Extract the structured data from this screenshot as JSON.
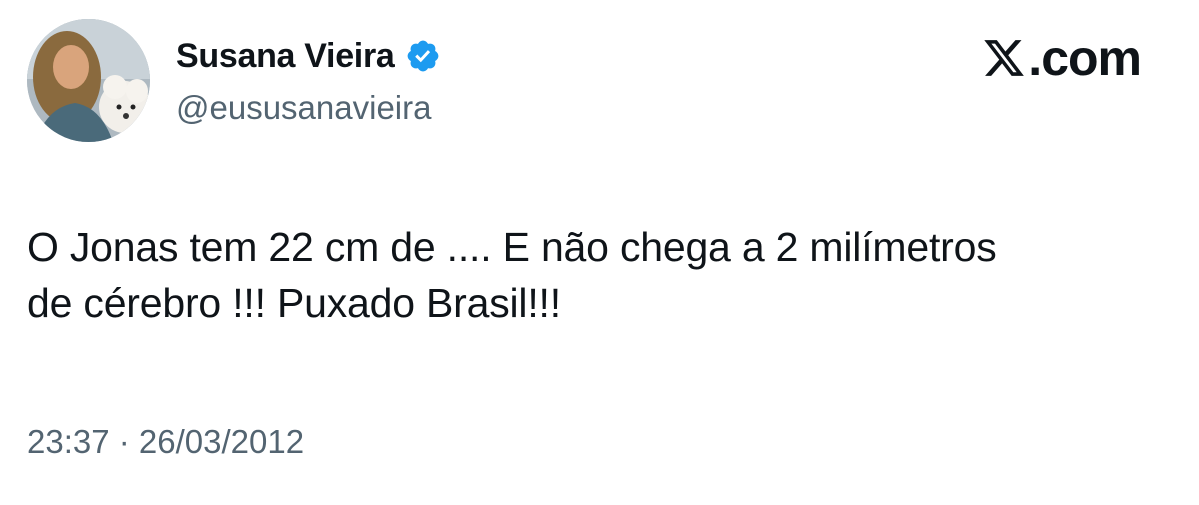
{
  "author": {
    "display_name": "Susana Vieira",
    "handle": "@eususanavieira",
    "verified": true,
    "verified_icon": "verified-badge-icon",
    "avatar_icon": "profile-photo-avatar"
  },
  "brand": {
    "logo_icon": "x-logo-icon",
    "text": ".com"
  },
  "tweet": {
    "text_line1": "O Jonas tem 22 cm de .... E não chega a 2 milímetros",
    "text_line2": "de cérebro !!! Puxado Brasil!!!"
  },
  "meta": {
    "time": "23:37",
    "separator": " · ",
    "date": "26/03/2012"
  },
  "colors": {
    "primary_text": "#0f1419",
    "secondary_text": "#536471",
    "verified_blue": "#1d9bf0",
    "background": "#ffffff"
  }
}
